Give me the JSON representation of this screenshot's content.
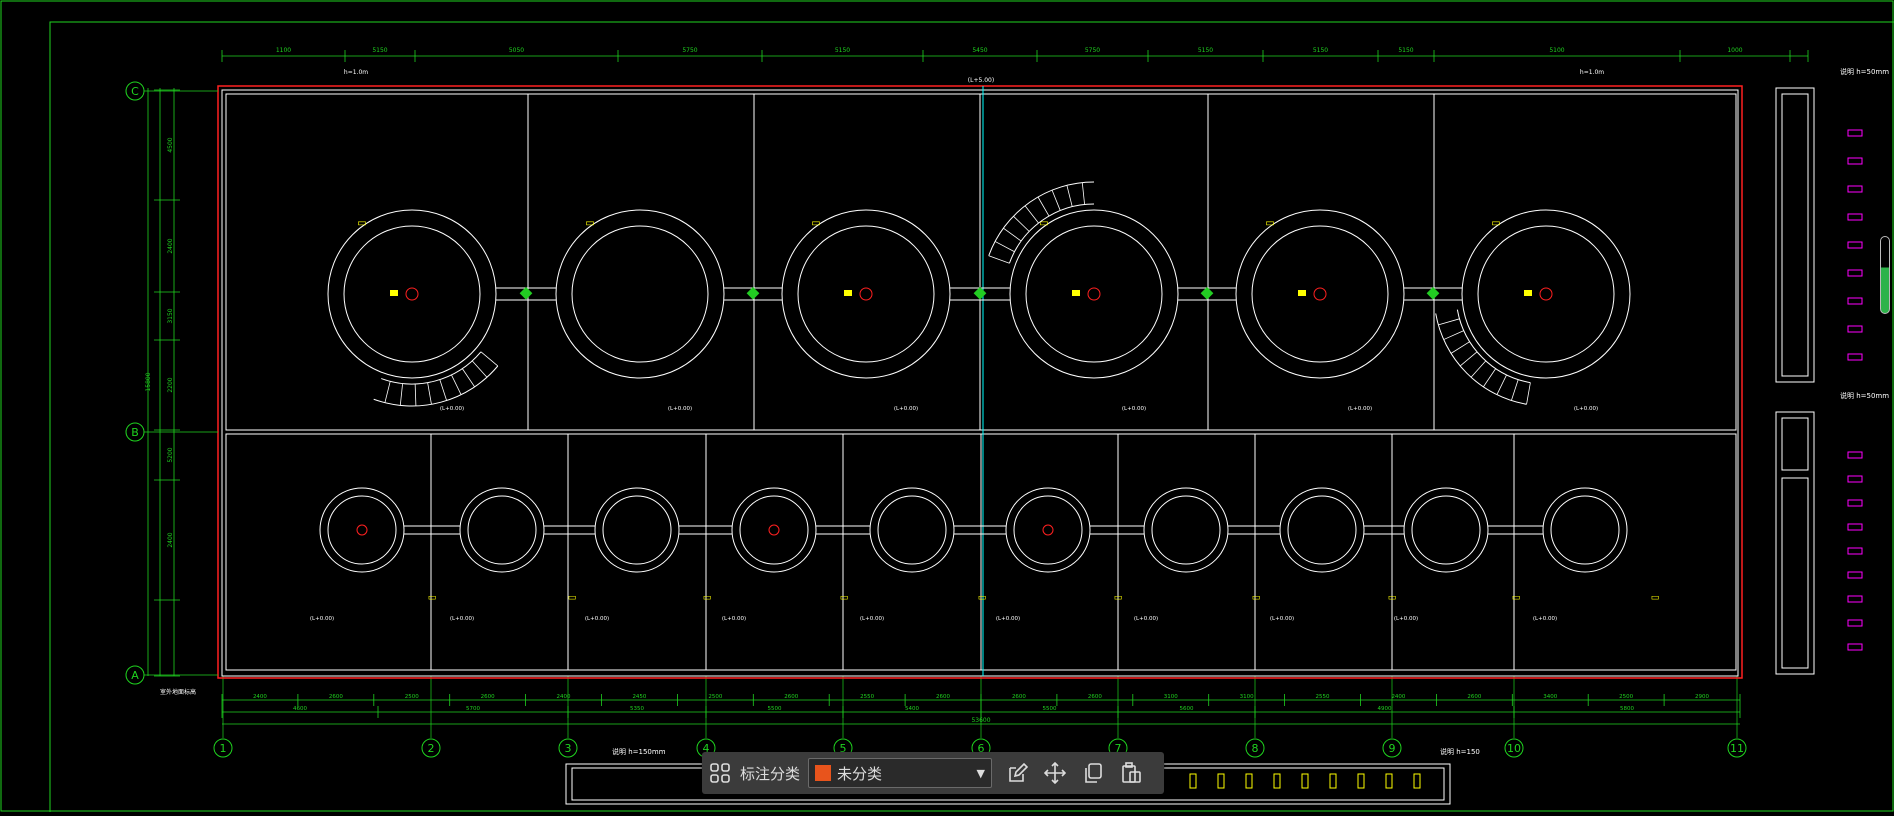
{
  "drawing": {
    "grid_columns": [
      "1",
      "2",
      "3",
      "4",
      "5",
      "6",
      "7",
      "8",
      "9",
      "10",
      "11"
    ],
    "grid_rows": [
      "C",
      "B",
      "A"
    ],
    "top_dims": [
      "1100",
      "5150",
      "5050",
      "5750",
      "5150",
      "5450",
      "5750",
      "5150",
      "5150",
      "5150",
      "5100",
      "1000"
    ],
    "bottom_dims_row1": [
      "2400",
      "2600",
      "2500",
      "2600",
      "2400",
      "2450",
      "2500",
      "2600",
      "2550",
      "2600",
      "2600",
      "2600",
      "3100",
      "3100",
      "2550",
      "2400",
      "2600",
      "3400",
      "2500",
      "2900"
    ],
    "bottom_dims_row2": [
      "4600",
      "5700",
      "5350",
      "5500",
      "5400",
      "5500",
      "5600",
      "4900",
      "5800"
    ],
    "bottom_total": "53600",
    "left_dims": [
      "4500",
      "2400",
      "3150",
      "2200",
      "5200",
      "2400"
    ],
    "left_total": "15800",
    "labels": {
      "top_center": "(L+5.00)",
      "corner_note": "h=1.0m",
      "legend_top": "说明 h=50mm",
      "legend_mid": "说明 h=50mm",
      "legend_bottom": "说明 h=150mm",
      "legend_bottom_right": "说明 h=150",
      "bottom_left_note": "室外地面标高"
    },
    "top_pool_labels": [
      "(L+0.00)",
      "(L+0.00)",
      "(L+0.00)",
      "(L+0.00)",
      "(L+0.00)",
      "(L+0.00)"
    ],
    "bottom_pool_labels": [
      "(L+0.00)",
      "(L+0.00)",
      "(L+0.00)",
      "(L+0.00)",
      "(L+0.00)",
      "(L+0.00)",
      "(L+0.00)",
      "(L+0.00)",
      "(L+0.00)",
      "(L+0.00)"
    ]
  },
  "toolbar": {
    "category_label": "标注分类",
    "selected_value": "未分类",
    "swatch_color": "#e8541c"
  },
  "colors": {
    "line": "#ffffff",
    "dim": "#1fd31f",
    "accent_red": "#ff2020",
    "yellow": "#ffff00",
    "cyan": "#00ffff",
    "magenta": "#ff00ff"
  }
}
